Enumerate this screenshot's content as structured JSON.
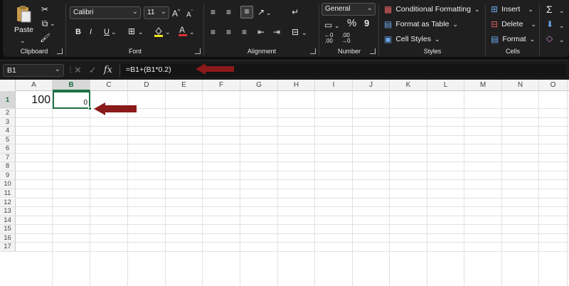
{
  "ribbon": {
    "clipboard": {
      "paste_label": "Paste",
      "group_label": "Clipboard"
    },
    "font": {
      "font_name": "Calibri",
      "font_size": "11",
      "group_label": "Font",
      "bold": "B",
      "italic": "I",
      "underline": "U"
    },
    "alignment": {
      "group_label": "Alignment"
    },
    "number": {
      "format": "General",
      "percent": "%",
      "comma": "9",
      "group_label": "Number"
    },
    "styles": {
      "conditional": "Conditional Formatting",
      "format_table": "Format as Table",
      "cell_styles": "Cell Styles",
      "group_label": "Styles"
    },
    "cells": {
      "insert": "Insert",
      "delete": "Delete",
      "format": "Format",
      "group_label": "Cells"
    }
  },
  "formula_bar": {
    "name_box": "B1",
    "fx": "fx",
    "formula": "=B1+(B1*0.2)"
  },
  "grid": {
    "columns": [
      "A",
      "B",
      "C",
      "D",
      "E",
      "F",
      "G",
      "H",
      "I",
      "J",
      "K",
      "L",
      "M",
      "N",
      "O"
    ],
    "selected_column": "B",
    "rows": [
      "1",
      "2",
      "3",
      "4",
      "5",
      "6",
      "7",
      "8",
      "9",
      "10",
      "11",
      "12",
      "13",
      "14",
      "15",
      "16",
      "17"
    ],
    "selected_row": "1",
    "cells": {
      "A1": "100",
      "B1": "0"
    }
  },
  "colors": {
    "accent": "#1e7145",
    "annotation_arrow": "#8b1a1a",
    "ribbon_bg": "#1f1f1f"
  }
}
